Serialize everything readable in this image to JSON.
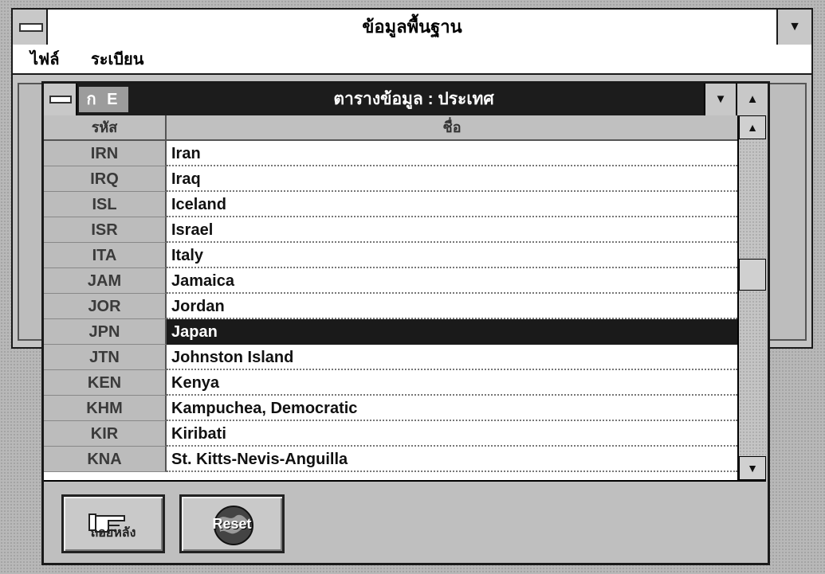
{
  "main_window": {
    "title": "ข้อมูลพื้นฐาน",
    "menu": [
      "ไฟล์",
      "ระเบียน"
    ]
  },
  "child_window": {
    "title": "ตารางข้อมูล : ประเทศ",
    "icon_labels": "ก E"
  },
  "table": {
    "columns": [
      "รหัส",
      "ชื่อ"
    ],
    "rows": [
      {
        "code": "IRN",
        "name": "Iran"
      },
      {
        "code": "IRQ",
        "name": "Iraq"
      },
      {
        "code": "ISL",
        "name": "Iceland"
      },
      {
        "code": "ISR",
        "name": "Israel"
      },
      {
        "code": "ITA",
        "name": "Italy"
      },
      {
        "code": "JAM",
        "name": "Jamaica"
      },
      {
        "code": "JOR",
        "name": "Jordan"
      },
      {
        "code": "JPN",
        "name": "Japan",
        "selected": true
      },
      {
        "code": "JTN",
        "name": "Johnston Island"
      },
      {
        "code": "KEN",
        "name": "Kenya"
      },
      {
        "code": "KHM",
        "name": "Kampuchea, Democratic"
      },
      {
        "code": "KIR",
        "name": "Kiribati"
      },
      {
        "code": "KNA",
        "name": "St. Kitts-Nevis-Anguilla"
      }
    ]
  },
  "buttons": {
    "back": {
      "label": "ถอยหลัง",
      "icon": "pointing-hand-icon"
    },
    "reset": {
      "label": "Reset",
      "icon": "globe-icon"
    }
  },
  "colors": {
    "title_bar_active": "#1c1c1c",
    "selection": "#1a1a1a"
  }
}
